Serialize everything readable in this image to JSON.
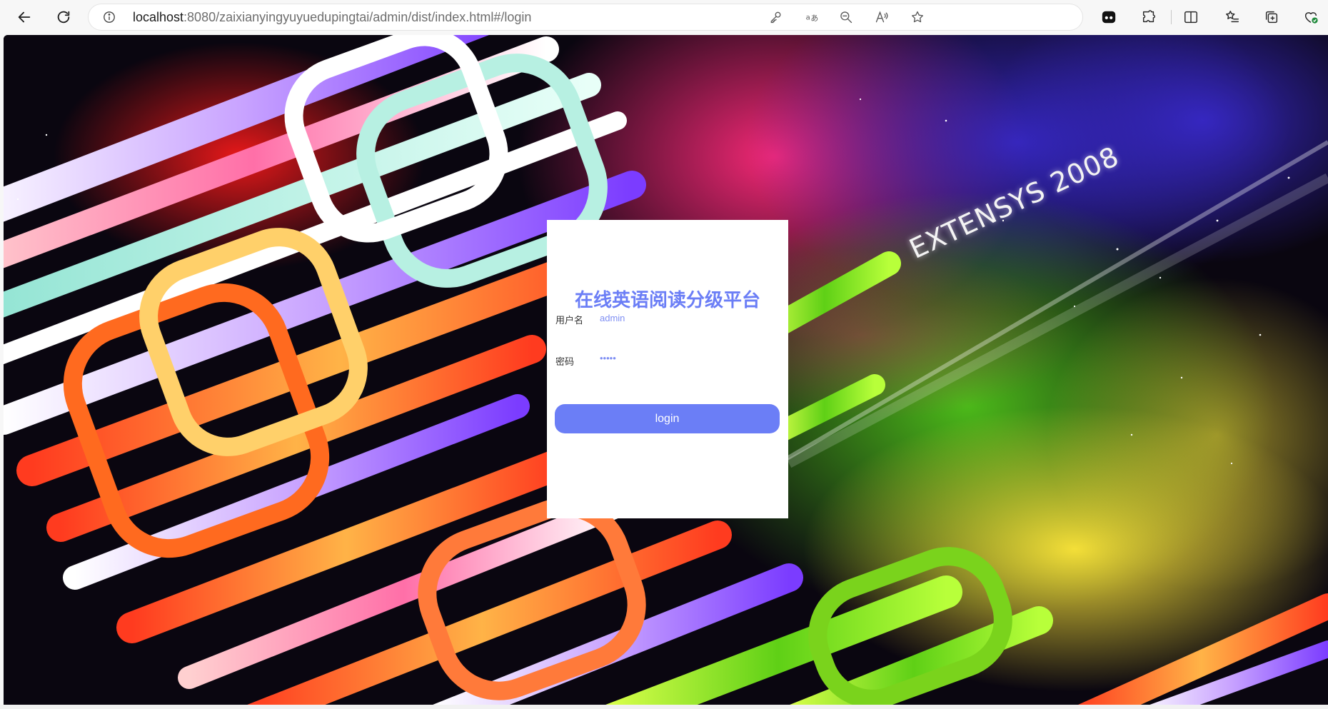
{
  "browser": {
    "url_host": "localhost",
    "url_rest": ":8080/zaixianyingyuyuedupingtai/admin/dist/index.html#/login",
    "icons": {
      "back": "back-arrow-icon",
      "refresh": "refresh-icon",
      "site_info": "info-icon",
      "url_bar_actions": [
        "key-icon",
        "translate-icon",
        "zoom-out-icon",
        "read-aloud-icon",
        "favorite-star-icon"
      ],
      "toolbar_actions": [
        "media-extension-icon",
        "extensions-puzzle-icon",
        "split-screen-icon",
        "favorites-list-icon",
        "collections-icon",
        "browser-essentials-icon"
      ]
    }
  },
  "background": {
    "watermark_text": "EXTENSYS 2008"
  },
  "login": {
    "title": "在线英语阅读分级平台",
    "username_label": "用户名",
    "username_value": "admin",
    "password_label": "密码",
    "password_value": "admin",
    "button_label": "login"
  },
  "colors": {
    "accent": "#6b7ef6",
    "input_text": "#7f8ff3",
    "card_bg": "#ffffff"
  }
}
